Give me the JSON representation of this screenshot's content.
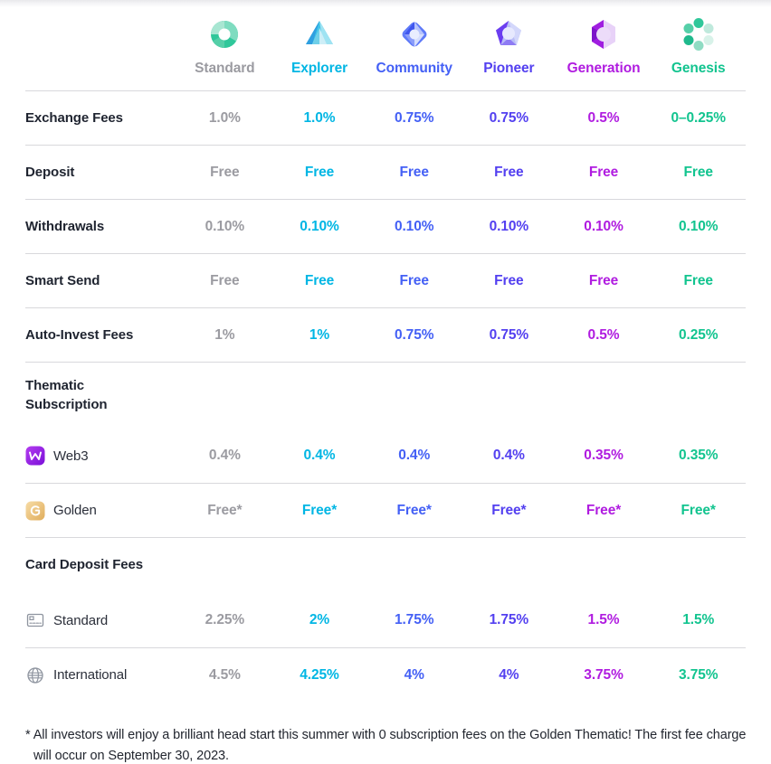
{
  "colors": {
    "standard": "#9b9ba1",
    "explorer": "#00b6e4",
    "community": "#4460f5",
    "pioneer": "#5340f0",
    "generation": "#b01ce0",
    "genesis": "#12c48f",
    "label": "#1f2430",
    "divider": "#d8d8dc"
  },
  "header": {
    "tiers": [
      {
        "name": "Standard",
        "icon": "gem-circle-icon",
        "color": "#9b9ba1"
      },
      {
        "name": "Explorer",
        "icon": "gem-triangle-icon",
        "color": "#00b6e4"
      },
      {
        "name": "Community",
        "icon": "gem-diamond-icon",
        "color": "#4460f5"
      },
      {
        "name": "Pioneer",
        "icon": "gem-pentagon-icon",
        "color": "#5340f0"
      },
      {
        "name": "Generation",
        "icon": "gem-hexagon-icon",
        "color": "#b01ce0"
      },
      {
        "name": "Genesis",
        "icon": "gem-flower-icon",
        "color": "#12c48f"
      }
    ]
  },
  "rows": [
    {
      "label": "Exchange Fees",
      "values": [
        "1.0%",
        "1.0%",
        "0.75%",
        "0.75%",
        "0.5%",
        "0–0.25%"
      ]
    },
    {
      "label": "Deposit",
      "values": [
        "Free",
        "Free",
        "Free",
        "Free",
        "Free",
        "Free"
      ]
    },
    {
      "label": "Withdrawals",
      "values": [
        "0.10%",
        "0.10%",
        "0.10%",
        "0.10%",
        "0.10%",
        "0.10%"
      ]
    },
    {
      "label": "Smart Send",
      "values": [
        "Free",
        "Free",
        "Free",
        "Free",
        "Free",
        "Free"
      ]
    },
    {
      "label": "Auto-Invest Fees",
      "values": [
        "1%",
        "1%",
        "0.75%",
        "0.75%",
        "0.5%",
        "0.25%"
      ]
    }
  ],
  "thematic": {
    "section_title_line1": "Thematic",
    "section_title_line2": "Subscription",
    "rows": [
      {
        "label": "Web3",
        "icon": "web3-app-icon",
        "values": [
          "0.4%",
          "0.4%",
          "0.4%",
          "0.4%",
          "0.35%",
          "0.35%"
        ]
      },
      {
        "label": "Golden",
        "icon": "golden-app-icon",
        "values": [
          "Free*",
          "Free*",
          "Free*",
          "Free*",
          "Free*",
          "Free*"
        ]
      }
    ]
  },
  "card_deposit": {
    "section_title": "Card Deposit Fees",
    "rows": [
      {
        "label": "Standard",
        "icon": "credit-card-icon",
        "values": [
          "2.25%",
          "2%",
          "1.75%",
          "1.75%",
          "1.5%",
          "1.5%"
        ]
      },
      {
        "label": "International",
        "icon": "globe-icon",
        "values": [
          "4.5%",
          "4.25%",
          "4%",
          "4%",
          "3.75%",
          "3.75%"
        ]
      }
    ]
  },
  "footnote": {
    "marker": "*",
    "text": "All investors will enjoy a brilliant head start this summer with 0 subscription fees on the Golden Thematic! The first fee charge will occur on September 30, 2023."
  }
}
